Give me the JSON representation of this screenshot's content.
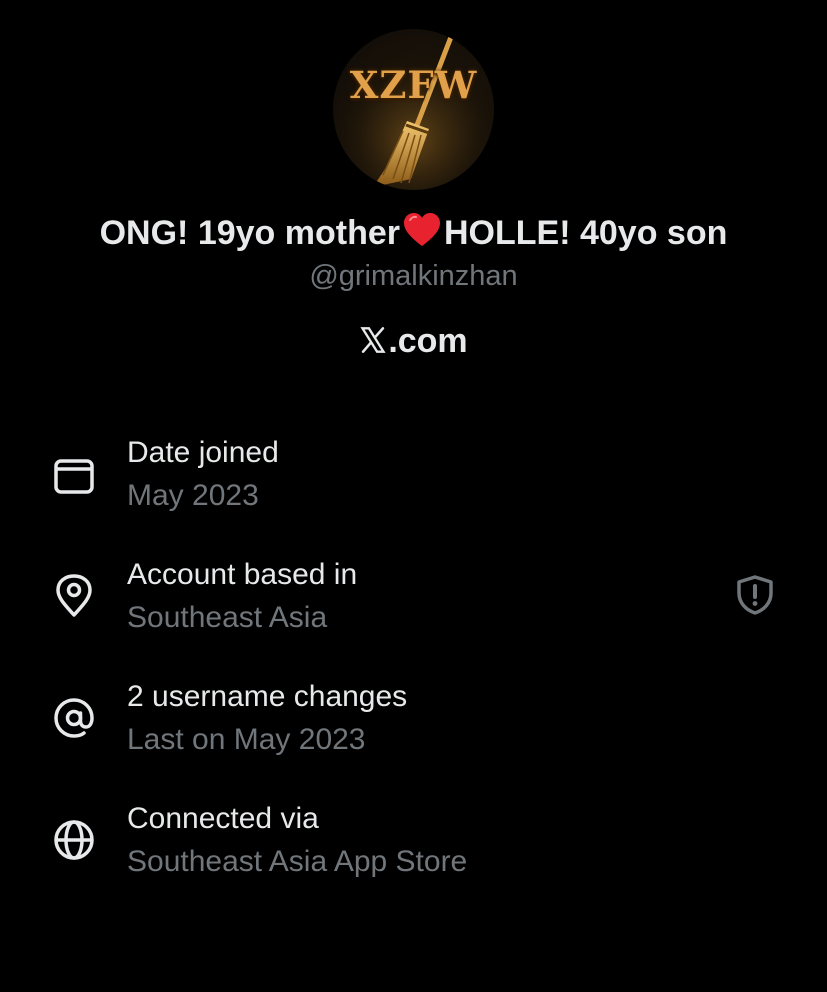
{
  "profile": {
    "avatar_text": "XZFW",
    "display_name_part1": "ONG! 19yo mother",
    "display_name_emoji": "red-heart-emoji",
    "display_name_part2": "HOLLE! 40yo son",
    "handle": "@grimalkinzhan",
    "site_prefix_icon": "x-logo-icon",
    "site_suffix": ".com"
  },
  "about": {
    "items": [
      {
        "icon": "calendar-icon",
        "title": "Date joined",
        "subtitle": "May 2023"
      },
      {
        "icon": "location-pin-icon",
        "title": "Account based in",
        "subtitle": "Southeast Asia",
        "trailing_icon": "shield-alert-icon"
      },
      {
        "icon": "at-sign-icon",
        "title": "2 username changes",
        "subtitle": "Last on May 2023"
      },
      {
        "icon": "globe-icon",
        "title": "Connected via",
        "subtitle": "Southeast Asia App Store"
      }
    ]
  },
  "colors": {
    "background": "#000000",
    "primary_text": "#e7e9ea",
    "secondary_text": "#71767b",
    "heart": "#e8232f",
    "avatar_gold": "#e0a14a"
  }
}
